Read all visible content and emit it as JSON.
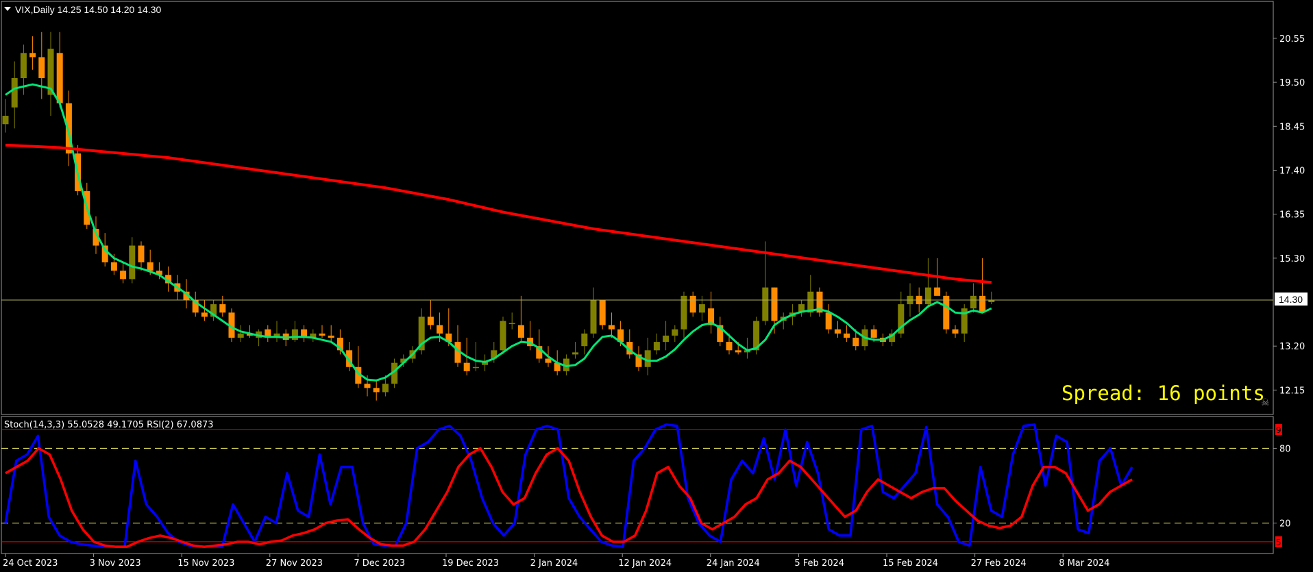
{
  "symbol_header": "VIX,Daily  14.25 14.50 14.20 14.30",
  "indicator_header": "Stoch(14,3,3) 55.0528 49.1705  RSI(2) 67.0873",
  "spread_text": "Spread: 16 points",
  "current_price_label": "14.30",
  "price_axis_labels": [
    "20.55",
    "19.50",
    "18.45",
    "17.40",
    "16.35",
    "15.30",
    "13.20",
    "12.15"
  ],
  "indicator_axis_labels": [
    "80",
    "20"
  ],
  "indicator_marker_top": "95",
  "indicator_marker_bottom": "5",
  "time_axis_labels": [
    "24 Oct 2023",
    "3 Nov 2023",
    "15 Nov 2023",
    "27 Nov 2023",
    "7 Dec 2023",
    "19 Dec 2023",
    "2 Jan 2024",
    "12 Jan 2024",
    "24 Jan 2024",
    "5 Feb 2024",
    "15 Feb 2024",
    "27 Feb 2024",
    "8 Mar 2024"
  ],
  "colors": {
    "background": "#000000",
    "bull_candle": "#808000",
    "bear_candle": "#ff8c00",
    "ma_fast": "#00e676",
    "ma_slow": "#ff0000",
    "stoch_main": "#0000ff",
    "stoch_signal": "#ff0000",
    "price_line": "#b0b060",
    "spread_text": "#ffff00",
    "level_line": "#ffff66"
  },
  "chart_data": [
    {
      "type": "candlestick",
      "title": "VIX,Daily",
      "ylim": [
        11.6,
        21.4
      ],
      "current_price": 14.3,
      "ohlc": [
        [
          18.5,
          19.1,
          18.3,
          18.7
        ],
        [
          18.9,
          20.0,
          18.4,
          19.6
        ],
        [
          19.6,
          20.4,
          19.2,
          20.2
        ],
        [
          20.2,
          20.6,
          19.8,
          20.1
        ],
        [
          20.1,
          20.7,
          19.1,
          19.6
        ],
        [
          19.2,
          20.7,
          18.7,
          20.3
        ],
        [
          20.2,
          20.7,
          18.9,
          19.0
        ],
        [
          19.0,
          19.3,
          17.5,
          17.8
        ],
        [
          17.8,
          18.0,
          16.8,
          16.9
        ],
        [
          16.9,
          17.1,
          16.0,
          16.1
        ],
        [
          16.0,
          16.3,
          15.4,
          15.6
        ],
        [
          15.6,
          15.9,
          15.1,
          15.2
        ],
        [
          15.2,
          15.4,
          14.9,
          15.0
        ],
        [
          15.0,
          15.2,
          14.7,
          14.8
        ],
        [
          14.8,
          15.8,
          14.7,
          15.6
        ],
        [
          15.6,
          15.7,
          15.0,
          15.2
        ],
        [
          15.2,
          15.5,
          14.9,
          15.0
        ],
        [
          15.0,
          15.2,
          14.8,
          14.9
        ],
        [
          14.9,
          15.1,
          14.5,
          14.7
        ],
        [
          14.7,
          14.9,
          14.3,
          14.5
        ],
        [
          14.5,
          14.8,
          14.1,
          14.3
        ],
        [
          14.3,
          14.5,
          13.9,
          14.0
        ],
        [
          14.0,
          14.3,
          13.8,
          13.9
        ],
        [
          13.9,
          14.3,
          13.8,
          14.2
        ],
        [
          14.2,
          14.4,
          13.9,
          14.0
        ],
        [
          14.0,
          14.1,
          13.3,
          13.4
        ],
        [
          13.4,
          13.7,
          13.3,
          13.5
        ],
        [
          13.5,
          13.7,
          13.4,
          13.45
        ],
        [
          13.4,
          13.6,
          13.2,
          13.55
        ],
        [
          13.6,
          13.7,
          13.3,
          13.4
        ],
        [
          13.4,
          13.8,
          13.3,
          13.5
        ],
        [
          13.5,
          13.6,
          13.2,
          13.35
        ],
        [
          13.35,
          13.8,
          13.3,
          13.6
        ],
        [
          13.6,
          13.7,
          13.3,
          13.4
        ],
        [
          13.4,
          13.6,
          13.3,
          13.5
        ],
        [
          13.5,
          13.7,
          13.4,
          13.45
        ],
        [
          13.45,
          13.7,
          13.3,
          13.4
        ],
        [
          13.4,
          13.6,
          13.0,
          13.1
        ],
        [
          13.1,
          13.3,
          12.6,
          12.7
        ],
        [
          12.7,
          13.2,
          12.2,
          12.3
        ],
        [
          12.3,
          12.5,
          12.0,
          12.2
        ],
        [
          12.2,
          12.4,
          11.9,
          12.1
        ],
        [
          12.1,
          12.5,
          12.0,
          12.3
        ],
        [
          12.3,
          12.9,
          12.2,
          12.8
        ],
        [
          12.8,
          13.0,
          12.7,
          12.9
        ],
        [
          12.9,
          13.2,
          12.8,
          13.1
        ],
        [
          13.1,
          14.1,
          13.0,
          13.9
        ],
        [
          13.9,
          14.3,
          13.6,
          13.7
        ],
        [
          13.7,
          14.0,
          13.3,
          13.5
        ],
        [
          13.5,
          14.1,
          13.2,
          13.3
        ],
        [
          13.3,
          13.7,
          12.7,
          12.8
        ],
        [
          12.8,
          13.4,
          12.5,
          12.6
        ],
        [
          12.7,
          13.3,
          12.6,
          12.7
        ],
        [
          12.75,
          13.0,
          12.6,
          12.85
        ],
        [
          12.9,
          13.3,
          12.8,
          13.1
        ],
        [
          13.1,
          13.9,
          13.0,
          13.8
        ],
        [
          13.75,
          14.0,
          13.6,
          13.75
        ],
        [
          13.7,
          14.4,
          13.3,
          13.4
        ],
        [
          13.4,
          13.8,
          13.1,
          13.2
        ],
        [
          13.2,
          13.6,
          12.8,
          12.9
        ],
        [
          12.9,
          13.2,
          12.7,
          12.8
        ],
        [
          12.8,
          13.1,
          12.5,
          12.6
        ],
        [
          12.6,
          13.0,
          12.5,
          12.9
        ],
        [
          13.0,
          13.3,
          12.9,
          13.05
        ],
        [
          13.2,
          13.6,
          13.0,
          13.5
        ],
        [
          13.5,
          14.6,
          13.4,
          14.3
        ],
        [
          14.3,
          14.3,
          13.6,
          13.7
        ],
        [
          13.7,
          14.0,
          13.4,
          13.6
        ],
        [
          13.6,
          13.8,
          13.2,
          13.3
        ],
        [
          13.3,
          13.6,
          12.9,
          13.0
        ],
        [
          13.0,
          13.2,
          12.6,
          12.7
        ],
        [
          12.7,
          13.4,
          12.5,
          13.1
        ],
        [
          13.1,
          13.5,
          13.0,
          13.3
        ],
        [
          13.3,
          13.8,
          13.1,
          13.45
        ],
        [
          13.45,
          13.7,
          13.3,
          13.6
        ],
        [
          13.6,
          14.5,
          13.4,
          14.4
        ],
        [
          14.4,
          14.5,
          13.9,
          14.0
        ],
        [
          14.0,
          14.4,
          13.8,
          14.2
        ],
        [
          14.1,
          14.5,
          13.5,
          13.7
        ],
        [
          13.7,
          13.9,
          13.2,
          13.3
        ],
        [
          13.3,
          13.5,
          13.0,
          13.1
        ],
        [
          13.1,
          13.3,
          13.0,
          13.05
        ],
        [
          13.05,
          13.4,
          12.9,
          13.1
        ],
        [
          13.1,
          13.9,
          13.0,
          13.8
        ],
        [
          13.8,
          15.7,
          13.7,
          14.6
        ],
        [
          14.6,
          14.6,
          13.5,
          13.8
        ],
        [
          13.8,
          14.0,
          13.6,
          13.9
        ],
        [
          13.9,
          14.2,
          13.7,
          14.0
        ],
        [
          14.0,
          14.3,
          13.9,
          14.2
        ],
        [
          14.0,
          14.9,
          13.9,
          14.5
        ],
        [
          14.5,
          14.6,
          13.9,
          14.0
        ],
        [
          14.0,
          14.2,
          13.5,
          13.6
        ],
        [
          13.6,
          13.8,
          13.4,
          13.5
        ],
        [
          13.5,
          13.7,
          13.3,
          13.4
        ],
        [
          13.4,
          13.6,
          13.1,
          13.2
        ],
        [
          13.2,
          13.7,
          13.1,
          13.6
        ],
        [
          13.6,
          13.7,
          13.3,
          13.4
        ],
        [
          13.4,
          13.5,
          13.2,
          13.3
        ],
        [
          13.3,
          13.6,
          13.2,
          13.5
        ],
        [
          13.5,
          14.5,
          13.4,
          14.2
        ],
        [
          14.2,
          14.7,
          13.9,
          14.4
        ],
        [
          14.4,
          14.6,
          14.0,
          14.2
        ],
        [
          14.2,
          15.3,
          14.1,
          14.6
        ],
        [
          14.6,
          15.3,
          14.5,
          14.4
        ],
        [
          14.4,
          14.5,
          13.5,
          13.6
        ],
        [
          13.6,
          13.7,
          13.4,
          13.5
        ],
        [
          13.5,
          14.2,
          13.3,
          14.1
        ],
        [
          14.1,
          14.7,
          14.0,
          14.4
        ],
        [
          14.4,
          15.3,
          14.0,
          14.0
        ],
        [
          14.25,
          14.5,
          14.2,
          14.3
        ]
      ],
      "series": [
        {
          "name": "MA fast",
          "color": "#00e676",
          "values": [
            19.2,
            19.35,
            19.4,
            19.45,
            19.4,
            19.35,
            19.0,
            18.3,
            17.3,
            16.5,
            15.9,
            15.5,
            15.3,
            15.2,
            15.1,
            15.05,
            14.98,
            14.9,
            14.75,
            14.6,
            14.45,
            14.25,
            14.1,
            13.95,
            13.8,
            13.65,
            13.55,
            13.5,
            13.45,
            13.42,
            13.42,
            13.4,
            13.42,
            13.42,
            13.4,
            13.35,
            13.3,
            13.15,
            12.85,
            12.55,
            12.4,
            12.38,
            12.45,
            12.6,
            12.8,
            13.0,
            13.25,
            13.4,
            13.42,
            13.3,
            13.1,
            12.95,
            12.85,
            12.82,
            12.9,
            13.05,
            13.2,
            13.3,
            13.28,
            13.15,
            12.95,
            12.8,
            12.72,
            12.75,
            12.9,
            13.2,
            13.42,
            13.45,
            13.3,
            13.1,
            12.95,
            12.85,
            12.85,
            12.95,
            13.12,
            13.35,
            13.55,
            13.7,
            13.75,
            13.65,
            13.45,
            13.25,
            13.1,
            13.15,
            13.35,
            13.7,
            13.85,
            13.95,
            14.02,
            14.05,
            14.08,
            14.02,
            13.9,
            13.75,
            13.55,
            13.4,
            13.35,
            13.35,
            13.45,
            13.65,
            13.82,
            13.95,
            14.15,
            14.25,
            14.15,
            14.0,
            13.98,
            14.05,
            14.0,
            14.1
          ]
        },
        {
          "name": "MA slow",
          "color": "#ff0000",
          "values": [
            18.0,
            17.99,
            17.98,
            17.97,
            17.96,
            17.95,
            17.94,
            17.92,
            17.9,
            17.88,
            17.86,
            17.84,
            17.82,
            17.8,
            17.78,
            17.76,
            17.74,
            17.72,
            17.7,
            17.67,
            17.64,
            17.61,
            17.58,
            17.55,
            17.52,
            17.49,
            17.46,
            17.43,
            17.4,
            17.37,
            17.34,
            17.31,
            17.28,
            17.25,
            17.22,
            17.19,
            17.16,
            17.13,
            17.1,
            17.07,
            17.04,
            17.01,
            16.98,
            16.94,
            16.9,
            16.86,
            16.82,
            16.78,
            16.74,
            16.7,
            16.65,
            16.6,
            16.55,
            16.5,
            16.45,
            16.4,
            16.36,
            16.32,
            16.28,
            16.24,
            16.2,
            16.16,
            16.12,
            16.08,
            16.04,
            16.0,
            15.97,
            15.94,
            15.91,
            15.88,
            15.85,
            15.82,
            15.79,
            15.76,
            15.73,
            15.7,
            15.67,
            15.64,
            15.61,
            15.58,
            15.55,
            15.52,
            15.49,
            15.46,
            15.43,
            15.4,
            15.37,
            15.34,
            15.31,
            15.28,
            15.25,
            15.22,
            15.19,
            15.16,
            15.13,
            15.1,
            15.07,
            15.04,
            15.01,
            14.98,
            14.95,
            14.92,
            14.89,
            14.86,
            14.83,
            14.8,
            14.78,
            14.76,
            14.74,
            14.72
          ]
        }
      ]
    },
    {
      "type": "line",
      "title": "Stoch(14,3,3)",
      "ylim": [
        0,
        100
      ],
      "levels": [
        80,
        20
      ],
      "series": [
        {
          "name": "Stoch main",
          "color": "#0000ff",
          "values": [
            20,
            70,
            75,
            90,
            25,
            10,
            5,
            3,
            2,
            1,
            1,
            1,
            70,
            35,
            25,
            12,
            5,
            2,
            1,
            1,
            1,
            35,
            20,
            5,
            25,
            20,
            60,
            30,
            25,
            75,
            35,
            65,
            65,
            20,
            3,
            2,
            2,
            20,
            80,
            85,
            95,
            98,
            90,
            70,
            40,
            20,
            10,
            20,
            75,
            95,
            98,
            95,
            40,
            25,
            15,
            5,
            2,
            1,
            70,
            80,
            95,
            99,
            98,
            40,
            20,
            10,
            5,
            55,
            70,
            60,
            88,
            55,
            95,
            50,
            85,
            60,
            15,
            10,
            10,
            95,
            98,
            45,
            40,
            50,
            60,
            97,
            35,
            25,
            5,
            2,
            65,
            30,
            25,
            75,
            98,
            99,
            50,
            90,
            85,
            15,
            12,
            70,
            80,
            50,
            65
          ]
        },
        {
          "name": "Stoch signal",
          "color": "#ff0000",
          "values": [
            60,
            65,
            70,
            80,
            75,
            55,
            30,
            15,
            5,
            2,
            1,
            1,
            5,
            8,
            10,
            8,
            5,
            2,
            1,
            2,
            3,
            5,
            5,
            3,
            5,
            6,
            10,
            12,
            15,
            20,
            22,
            23,
            15,
            8,
            3,
            2,
            2,
            5,
            15,
            30,
            45,
            65,
            75,
            80,
            65,
            45,
            35,
            40,
            60,
            75,
            80,
            70,
            45,
            25,
            10,
            5,
            5,
            10,
            30,
            60,
            65,
            50,
            40,
            20,
            15,
            20,
            25,
            35,
            40,
            55,
            60,
            70,
            65,
            55,
            45,
            35,
            25,
            30,
            45,
            55,
            50,
            45,
            40,
            45,
            48,
            48,
            38,
            30,
            22,
            18,
            16,
            18,
            25,
            50,
            65,
            65,
            60,
            45,
            30,
            35,
            45,
            50,
            55
          ]
        }
      ]
    }
  ]
}
